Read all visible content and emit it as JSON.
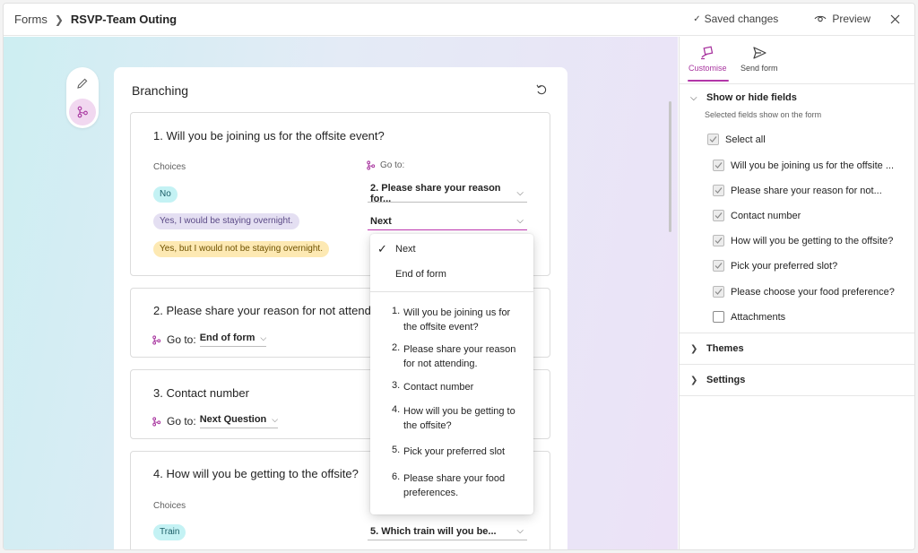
{
  "breadcrumb": {
    "root": "Forms",
    "current": "RSVP-Team Outing"
  },
  "header": {
    "saved": "Saved changes",
    "preview": "Preview"
  },
  "panel": {
    "title": "Branching"
  },
  "q1": {
    "title": "1. Will you be joining us for the offsite event?",
    "choices_label": "Choices",
    "goto_label": "Go to:",
    "choices": [
      {
        "label": "No",
        "goto": "2. Please share your reason for..."
      },
      {
        "label": "Yes, I would be staying overnight.",
        "goto": "Next"
      },
      {
        "label": "Yes, but I would not be staying overnight."
      }
    ]
  },
  "q2": {
    "title": "2. Please share your reason for not attending.",
    "goto_text": "Go to:",
    "goto_value": "End of form"
  },
  "q3": {
    "title": "3. Contact number",
    "goto_text": "Go to:",
    "goto_value": "Next Question"
  },
  "q4": {
    "title": "4. How will you be getting to the offsite?",
    "choices_label": "Choices",
    "choices": [
      {
        "label": "Train",
        "goto": "5. Which train will you be..."
      }
    ]
  },
  "menu": {
    "top": [
      "Next",
      "End of form"
    ],
    "questions": [
      {
        "num": "1.",
        "lines": [
          "Will you be joining us for",
          "the offsite event?"
        ]
      },
      {
        "num": "2.",
        "lines": [
          "Please share your reason",
          "for not attending."
        ]
      },
      {
        "num": "3.",
        "lines": [
          "Contact number"
        ]
      },
      {
        "num": "4.",
        "lines": [
          "How will you be getting to",
          "the offsite?"
        ]
      },
      {
        "num": "5.",
        "lines": [
          "Pick your preferred slot"
        ]
      },
      {
        "num": "6.",
        "lines": [
          "Please share your food",
          "preferences."
        ]
      }
    ]
  },
  "sidebar": {
    "tabs": [
      {
        "label": "Customise"
      },
      {
        "label": "Send form"
      }
    ],
    "show_hide": {
      "title": "Show or hide fields",
      "subtitle": "Selected fields show on the form",
      "select_all": "Select all",
      "fields": [
        {
          "label": "Will you be joining us for the offsite ...",
          "checked": true
        },
        {
          "label": "Please share your reason for not...",
          "checked": true
        },
        {
          "label": "Contact number",
          "checked": true
        },
        {
          "label": "How will you be getting to the offsite?",
          "checked": true
        },
        {
          "label": "Pick your preferred slot?",
          "checked": true
        },
        {
          "label": "Please choose your food preference?",
          "checked": true
        },
        {
          "label": "Attachments",
          "checked": false
        }
      ]
    },
    "themes": "Themes",
    "settings": "Settings"
  },
  "colors": {
    "accent": "#b236a8",
    "branch_icon": "#a8359f"
  }
}
